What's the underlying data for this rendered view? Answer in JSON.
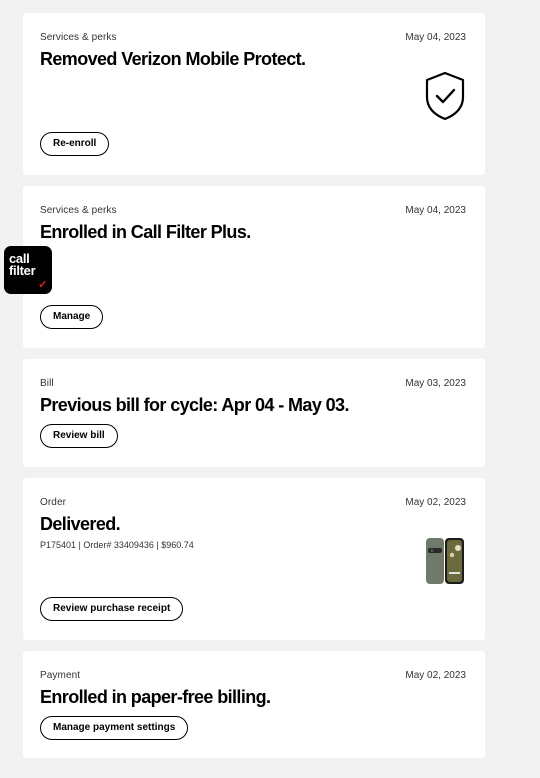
{
  "cards": [
    {
      "category": "Services & perks",
      "date": "May 04, 2023",
      "title": "Removed Verizon Mobile Protect.",
      "button": "Re-enroll",
      "icon": "shield-check-icon"
    },
    {
      "category": "Services & perks",
      "date": "May 04, 2023",
      "title": "Enrolled in Call Filter Plus.",
      "button": "Manage",
      "icon": "call-filter-app-icon",
      "icon_line1": "call",
      "icon_line2": "filter",
      "icon_mark": "✓"
    },
    {
      "category": "Bill",
      "date": "May 03, 2023",
      "title": "Previous bill for cycle: Apr 04 - May 03.",
      "button": "Review bill"
    },
    {
      "category": "Order",
      "date": "May 02, 2023",
      "title": "Delivered.",
      "subtitle": "P175401 | Order# 33409436 | $960.74",
      "button": "Review purchase receipt",
      "icon": "phone-image"
    },
    {
      "category": "Payment",
      "date": "May 02, 2023",
      "title": "Enrolled in paper-free billing.",
      "button": "Manage payment settings"
    }
  ],
  "colors": {
    "background": "#f2f2f2",
    "card": "#ffffff",
    "accent_red": "#e0201c"
  }
}
